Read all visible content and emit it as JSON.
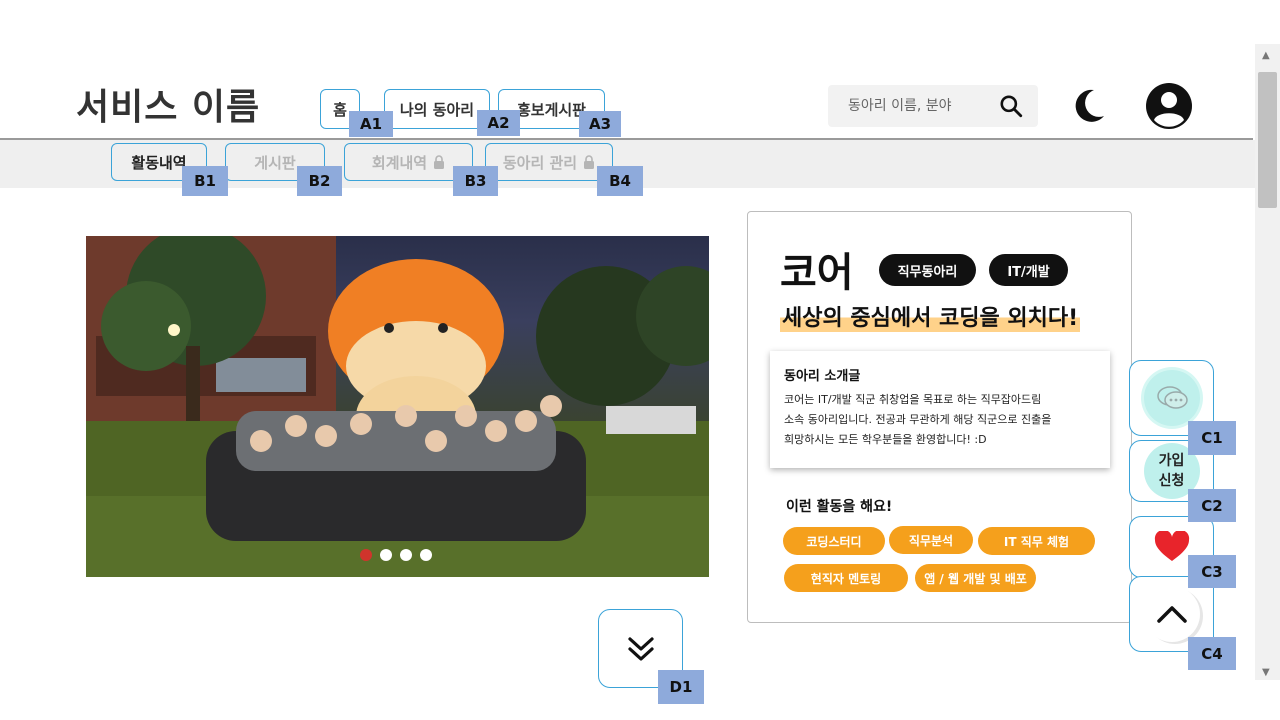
{
  "header": {
    "brand": "서비스 이름",
    "nav": [
      {
        "label": "홈",
        "tag": "A1"
      },
      {
        "label": "나의 동아리",
        "tag": "A2"
      },
      {
        "label": "홍보게시판",
        "tag": "A3"
      }
    ],
    "search_placeholder": "동아리 이름, 분야"
  },
  "subnav": [
    {
      "label": "활동내역",
      "tag": "B1",
      "locked": false
    },
    {
      "label": "게시판",
      "tag": "B2",
      "locked": false
    },
    {
      "label": "회계내역",
      "tag": "B3",
      "locked": true
    },
    {
      "label": "동아리 관리",
      "tag": "B4",
      "locked": true
    }
  ],
  "club": {
    "name": "코어",
    "chips": [
      "직무동아리",
      "IT/개발"
    ],
    "slogan": "세상의 중심에서 코딩을 외치다!",
    "intro_title": "동아리 소개글",
    "intro_lines": [
      "코어는 IT/개발 직군 취창업을 목표로 하는 직무잡아드림",
      "소속 동아리입니다. 전공과 무관하게 해당 직군으로 진출을",
      "희망하시는 모든 학우분들을 환영합니다! :D"
    ],
    "activities_title": "이런 활동을 해요!",
    "activities": [
      "코딩스터디",
      "직무분석",
      "IT 직무 체험",
      "현직자 멘토링",
      "앱 / 웹 개발 및 배포"
    ]
  },
  "carousel": {
    "count": 4,
    "active": 1
  },
  "fabs": {
    "join_line1": "가입",
    "join_line2": "신청",
    "tags": [
      "C1",
      "C2",
      "C3",
      "C4"
    ]
  },
  "scroll_down_tag": "D1",
  "colors": {
    "accent_border": "#3ba3d8",
    "tag_bg": "#8eaadb",
    "pill": "#f5a01c",
    "heart": "#e8242b",
    "highlight": "#ffd28a"
  }
}
